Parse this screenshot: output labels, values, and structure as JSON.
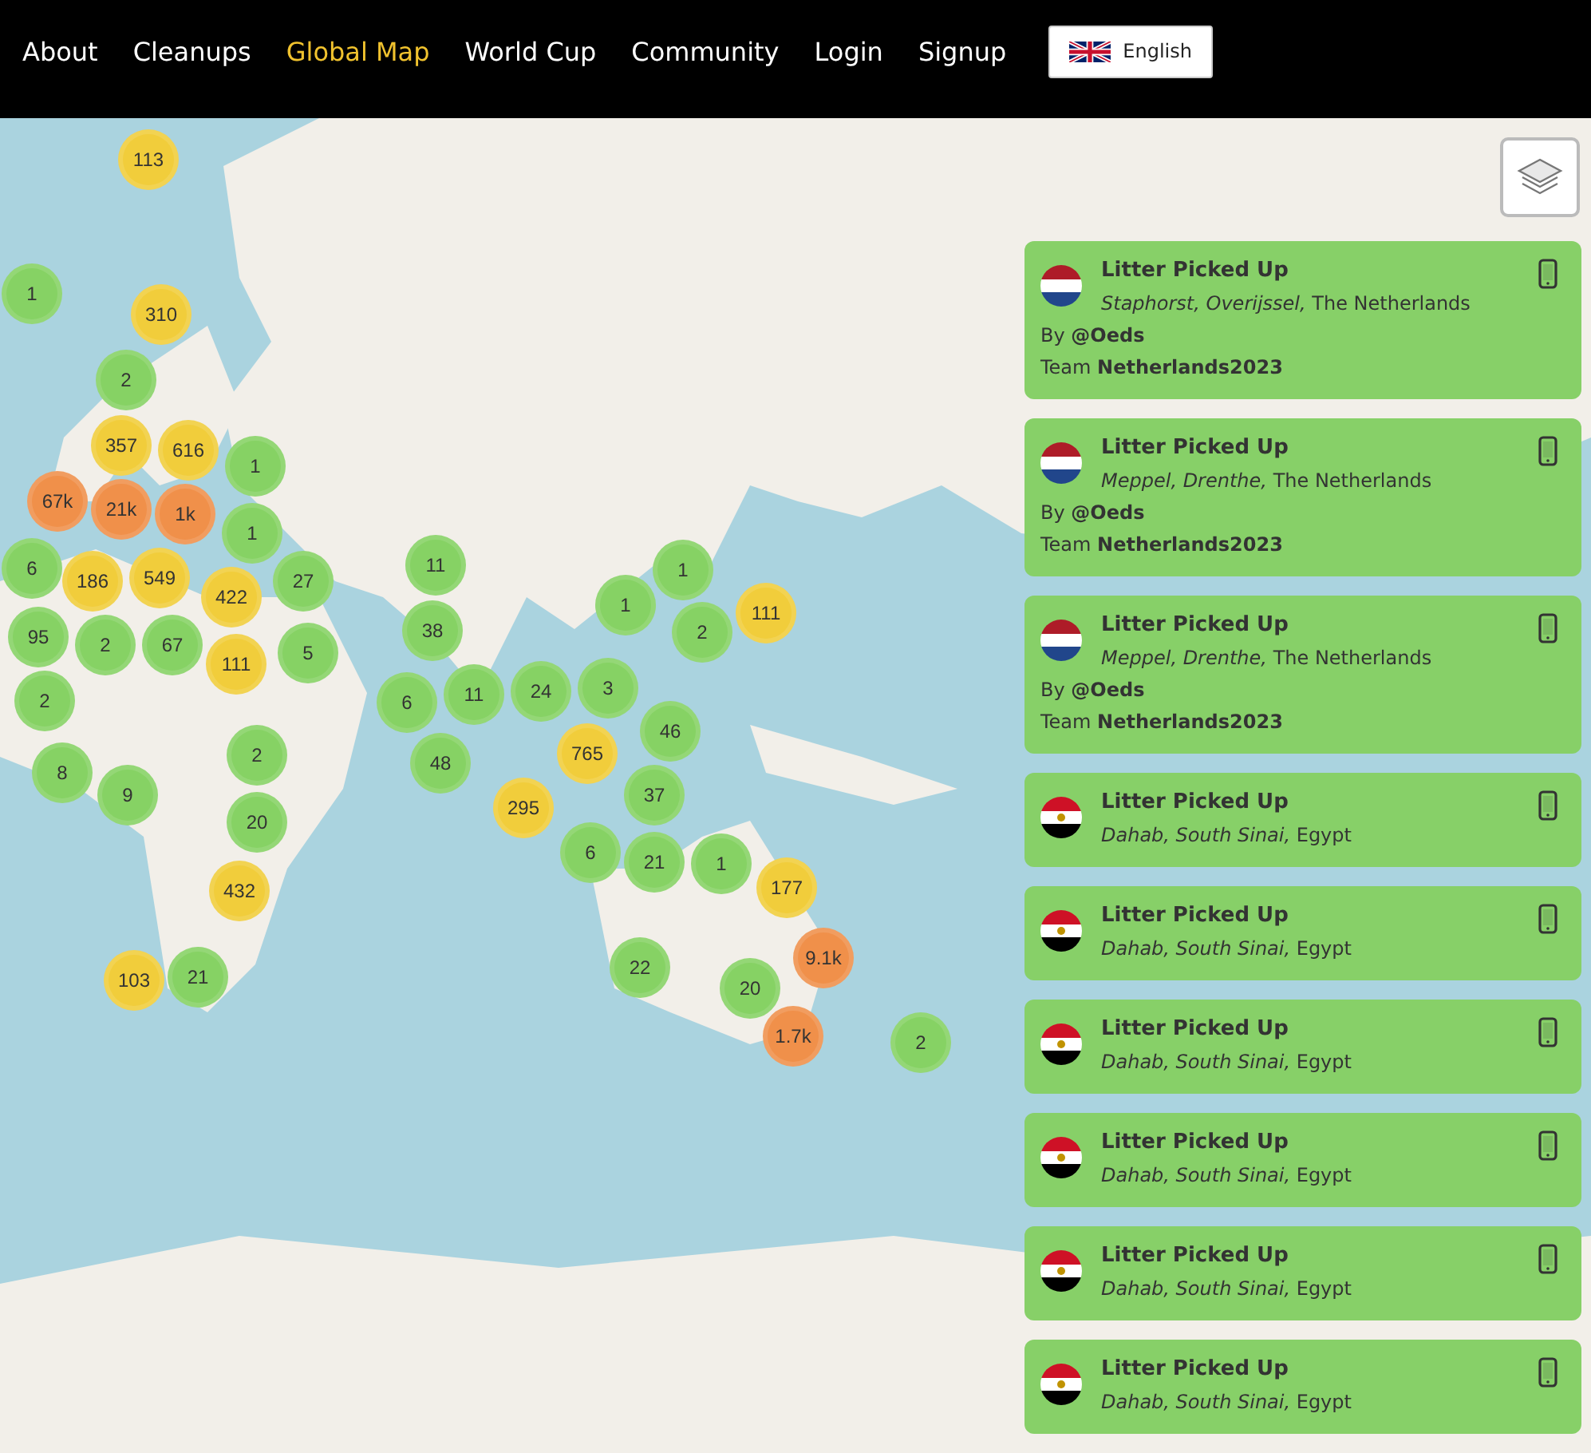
{
  "nav": {
    "items": [
      {
        "label": "About",
        "selected": false
      },
      {
        "label": "Cleanups",
        "selected": false
      },
      {
        "label": "Global Map",
        "selected": true
      },
      {
        "label": "World Cup",
        "selected": false
      },
      {
        "label": "Community",
        "selected": false
      },
      {
        "label": "Login",
        "selected": false
      },
      {
        "label": "Signup",
        "selected": false
      }
    ],
    "language": {
      "label": "English"
    }
  },
  "map": {
    "clusters": [
      {
        "count": "113",
        "color": "#f1cd3b"
      },
      {
        "count": "1",
        "color": "#86d264"
      },
      {
        "count": "310",
        "color": "#f1cd3b"
      },
      {
        "count": "2",
        "color": "#86d264"
      },
      {
        "count": "357",
        "color": "#f1cd3b"
      },
      {
        "count": "616",
        "color": "#f1cd3b"
      },
      {
        "count": "1",
        "color": "#86d264"
      },
      {
        "count": "67k",
        "color": "#f0904a"
      },
      {
        "count": "1",
        "color": "#86d264"
      },
      {
        "count": "21k",
        "color": "#f0904a"
      },
      {
        "count": "1k",
        "color": "#f0904a"
      },
      {
        "count": "6",
        "color": "#86d264"
      },
      {
        "count": "186",
        "color": "#f1cd3b"
      },
      {
        "count": "549",
        "color": "#f1cd3b"
      },
      {
        "count": "27",
        "color": "#86d264"
      },
      {
        "count": "95",
        "color": "#86d264"
      },
      {
        "count": "2",
        "color": "#86d264"
      },
      {
        "count": "67",
        "color": "#86d264"
      },
      {
        "count": "422",
        "color": "#f1cd3b"
      },
      {
        "count": "111",
        "color": "#f1cd3b"
      },
      {
        "count": "5",
        "color": "#86d264"
      },
      {
        "count": "2",
        "color": "#86d264"
      },
      {
        "count": "8",
        "color": "#86d264"
      },
      {
        "count": "9",
        "color": "#86d264"
      },
      {
        "count": "2",
        "color": "#86d264"
      },
      {
        "count": "20",
        "color": "#86d264"
      },
      {
        "count": "432",
        "color": "#f1cd3b"
      },
      {
        "count": "21",
        "color": "#86d264"
      },
      {
        "count": "103",
        "color": "#f1cd3b"
      },
      {
        "count": "11",
        "color": "#86d264"
      },
      {
        "count": "38",
        "color": "#86d264"
      },
      {
        "count": "6",
        "color": "#86d264"
      },
      {
        "count": "11",
        "color": "#86d264"
      },
      {
        "count": "48",
        "color": "#86d264"
      },
      {
        "count": "24",
        "color": "#86d264"
      },
      {
        "count": "1",
        "color": "#86d264"
      },
      {
        "count": "1",
        "color": "#86d264"
      },
      {
        "count": "111",
        "color": "#f1cd3b"
      },
      {
        "count": "2",
        "color": "#86d264"
      },
      {
        "count": "3",
        "color": "#86d264"
      },
      {
        "count": "46",
        "color": "#86d264"
      },
      {
        "count": "765",
        "color": "#f1cd3b"
      },
      {
        "count": "295",
        "color": "#f1cd3b"
      },
      {
        "count": "37",
        "color": "#86d264"
      },
      {
        "count": "6",
        "color": "#86d264"
      },
      {
        "count": "21",
        "color": "#86d264"
      },
      {
        "count": "1",
        "color": "#86d264"
      },
      {
        "count": "177",
        "color": "#f1cd3b"
      },
      {
        "count": "22",
        "color": "#86d264"
      },
      {
        "count": "20",
        "color": "#86d264"
      },
      {
        "count": "9.1k",
        "color": "#f0904a"
      },
      {
        "count": "1.7k",
        "color": "#f0904a"
      },
      {
        "count": "2",
        "color": "#86d264"
      }
    ]
  },
  "feed": [
    {
      "title": "Litter Picked Up",
      "kind": "netherlands",
      "place": "*Staphorst, Overijssel,* The Netherlands",
      "by": "By **@Oeds**",
      "team": "Team **Netherlands2023**"
    },
    {
      "title": "Litter Picked Up",
      "kind": "netherlands",
      "place": "*Meppel, Drenthe,* The Netherlands",
      "by": "By **@Oeds**",
      "team": "Team **Netherlands2023**"
    },
    {
      "title": "Litter Picked Up",
      "kind": "netherlands",
      "place": "*Meppel, Drenthe,* The Netherlands",
      "by": "By **@Oeds**",
      "team": "Team **Netherlands2023**"
    },
    {
      "title": "Litter Picked Up",
      "kind": "egypt",
      "place": "*Dahab, South Sinai,* Egypt"
    },
    {
      "title": "Litter Picked Up",
      "kind": "egypt",
      "place": "*Dahab, South Sinai,* Egypt"
    },
    {
      "title": "Litter Picked Up",
      "kind": "egypt",
      "place": "*Dahab, South Sinai,* Egypt"
    },
    {
      "title": "Litter Picked Up",
      "kind": "egypt",
      "place": "*Dahab, South Sinai,* Egypt"
    },
    {
      "title": "Litter Picked Up",
      "kind": "egypt",
      "place": "*Dahab, South Sinai,* Egypt"
    },
    {
      "title": "Litter Picked Up",
      "kind": "egypt",
      "place": "*Dahab, South Sinai,* Egypt"
    }
  ]
}
